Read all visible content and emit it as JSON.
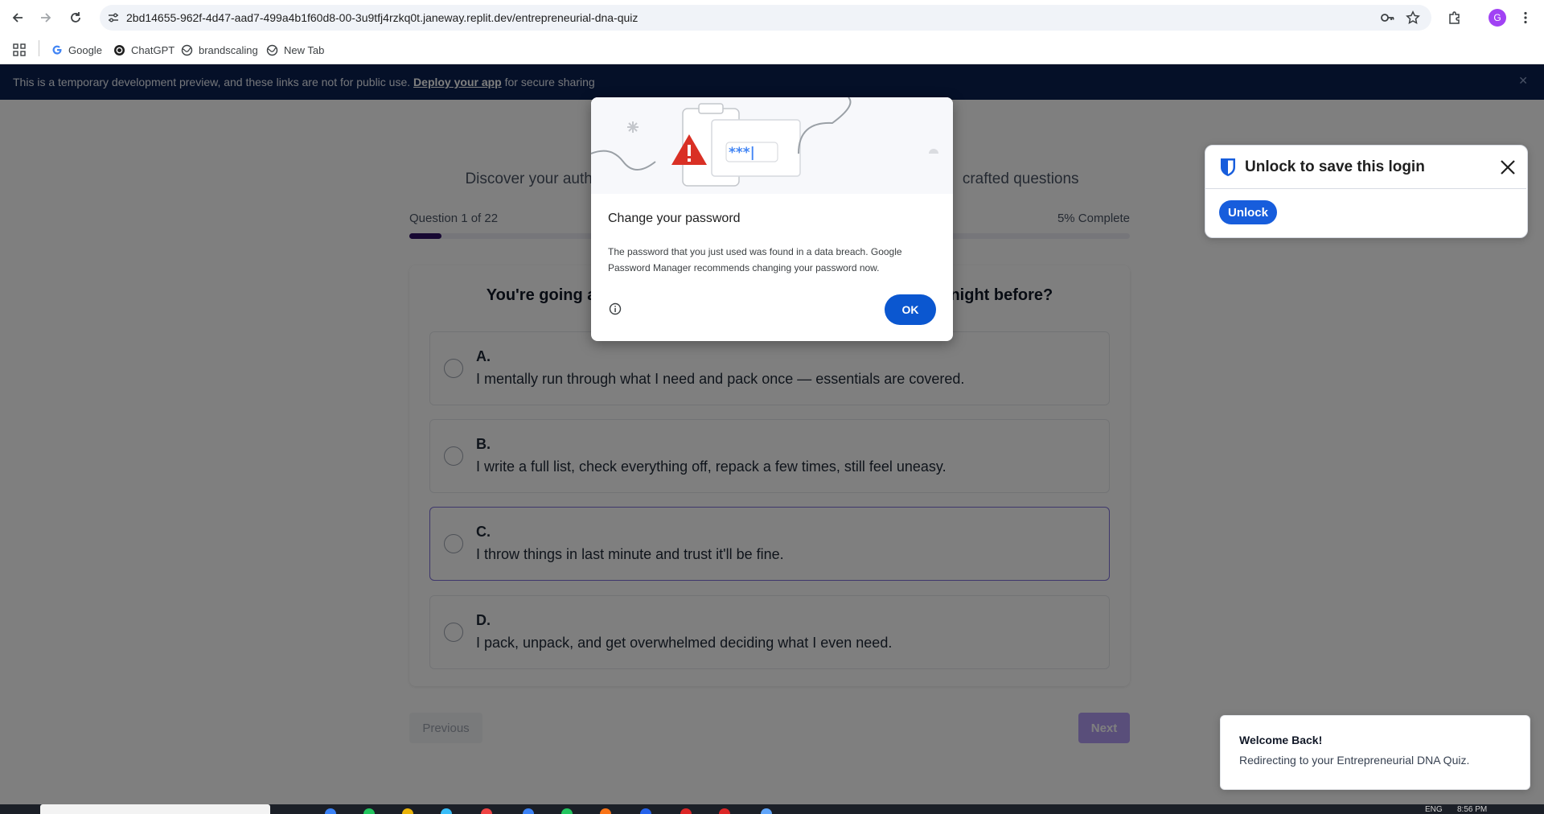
{
  "browser": {
    "url": "2bd14655-962f-4d47-aad7-499a4b1f60d8-00-3u9tfj4rzkq0t.janeway.replit.dev/entrepreneurial-dna-quiz",
    "profile_initial": "G",
    "accent_color": "#0b57d0",
    "bookmarks": [
      {
        "label": "Google",
        "icon": "google-icon"
      },
      {
        "label": "ChatGPT",
        "icon": "chatgpt-icon"
      },
      {
        "label": "brandscaling",
        "icon": "globe-icon"
      },
      {
        "label": "New Tab",
        "icon": "globe-icon"
      }
    ]
  },
  "dev_banner": {
    "text_before": "This is a temporary development preview, and these links are not for public use.",
    "link_text": "Deploy your app",
    "text_after": "for secure sharing",
    "background_color": "#0b2150"
  },
  "quiz": {
    "subtitle_left": "Discover your auth",
    "subtitle_right": "crafted questions",
    "progress_label": "Question 1 of 22",
    "progress_percent_text": "5% Complete",
    "progress_fraction": 0.045,
    "question": "You're going away for the weekend. How do you prepare the night before?",
    "options": [
      {
        "letter": "A.",
        "text": "I mentally run through what I need and pack once — essentials are covered."
      },
      {
        "letter": "B.",
        "text": "I write a full list, check everything off, repack a few times, still feel uneasy."
      },
      {
        "letter": "C.",
        "text": "I throw things in last minute and trust it'll be fine."
      },
      {
        "letter": "D.",
        "text": "I pack, unpack, and get overwhelmed deciding what I even need."
      }
    ],
    "previous_label": "Previous",
    "next_label": "Next"
  },
  "password_dialog": {
    "title": "Change your password",
    "body": "The password that you just used was found in a data breach. Google Password Manager recommends changing your password now.",
    "illustration_text": "***|",
    "ok_label": "OK"
  },
  "bitwarden": {
    "title": "Unlock to save this login",
    "unlock_label": "Unlock",
    "brand_color": "#175ddc"
  },
  "toast": {
    "title": "Welcome Back!",
    "message": "Redirecting to your Entrepreneurial DNA Quiz."
  },
  "taskbar": {
    "language": "ENG",
    "time": "8:56 PM"
  }
}
